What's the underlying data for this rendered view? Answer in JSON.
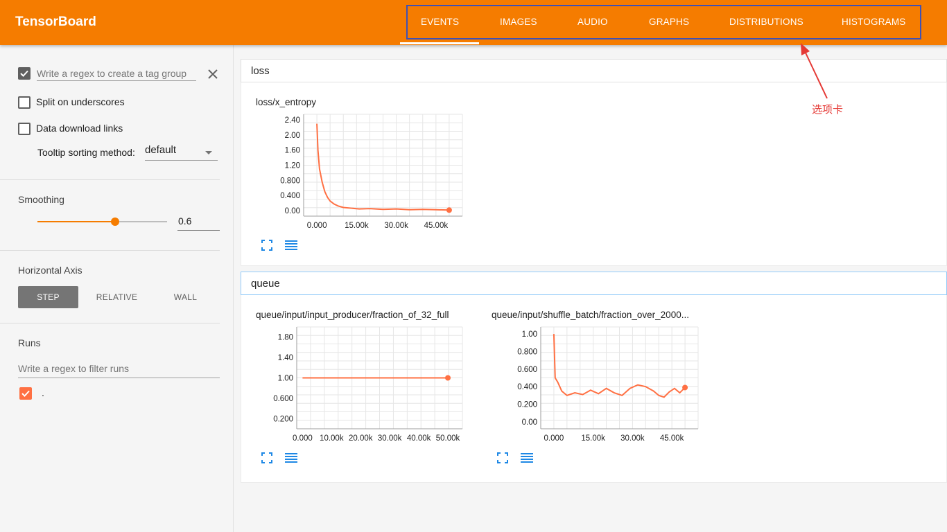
{
  "app": {
    "title": "TensorBoard"
  },
  "tabs": [
    {
      "label": "EVENTS",
      "active": true
    },
    {
      "label": "IMAGES"
    },
    {
      "label": "AUDIO"
    },
    {
      "label": "GRAPHS"
    },
    {
      "label": "DISTRIBUTIONS"
    },
    {
      "label": "HISTOGRAMS"
    }
  ],
  "annotation": {
    "text": "选项卡",
    "box_color": "#3f51b5",
    "text_color": "#e53935"
  },
  "sidebar": {
    "tag_regex": {
      "placeholder": "Write a regex to create a tag group",
      "checked": true
    },
    "split_underscores": {
      "label": "Split on underscores",
      "checked": false
    },
    "download_links": {
      "label": "Data download links",
      "checked": false
    },
    "tooltip": {
      "label": "Tooltip sorting method:",
      "value": "default"
    },
    "smoothing": {
      "title": "Smoothing",
      "value": "0.6",
      "fraction": 0.6
    },
    "horizontal_axis": {
      "title": "Horizontal Axis",
      "options": [
        "STEP",
        "RELATIVE",
        "WALL"
      ],
      "selected": "STEP"
    },
    "runs": {
      "title": "Runs",
      "placeholder": "Write a regex to filter runs",
      "items": [
        {
          "label": ".",
          "checked": true,
          "color": "#ff7043"
        }
      ]
    }
  },
  "groups": [
    {
      "name": "loss"
    },
    {
      "name": "queue"
    }
  ],
  "cards": {
    "loss": {
      "title": "loss/x_entropy"
    },
    "producer": {
      "title": "queue/input/input_producer/fraction_of_32_full"
    },
    "shuffle": {
      "title": "queue/input/shuffle_batch/fraction_over_2000..."
    }
  },
  "chart_data": [
    {
      "type": "line",
      "title": "loss/x_entropy",
      "y_ticks": [
        "2.40",
        "2.00",
        "1.60",
        "1.20",
        "0.800",
        "0.400",
        "0.00"
      ],
      "x_ticks": [
        "0.000",
        "15.00k",
        "30.00k",
        "45.00k"
      ],
      "xlim": [
        -5000,
        55000
      ],
      "ylim": [
        -0.15,
        2.55
      ],
      "series": [
        {
          "x": [
            0,
            400,
            1000,
            2000,
            3000,
            4000,
            5000,
            6500,
            8000,
            10000,
            13000,
            16000,
            20000,
            25000,
            30000,
            35000,
            40000,
            45000,
            50000
          ],
          "y": [
            2.3,
            1.6,
            1.1,
            0.75,
            0.5,
            0.35,
            0.25,
            0.17,
            0.12,
            0.08,
            0.06,
            0.04,
            0.05,
            0.03,
            0.04,
            0.02,
            0.03,
            0.02,
            0.01
          ]
        }
      ],
      "color": "#ff7043"
    },
    {
      "type": "line",
      "title": "queue/input/input_producer/fraction_of_32_full",
      "y_ticks": [
        "1.80",
        "1.40",
        "1.00",
        "0.600",
        "0.200"
      ],
      "x_ticks": [
        "0.000",
        "10.00k",
        "20.00k",
        "30.00k",
        "40.00k",
        "50.00k"
      ],
      "xlim": [
        -2000,
        55000
      ],
      "ylim": [
        0,
        2.0
      ],
      "series": [
        {
          "x": [
            0,
            50000
          ],
          "y": [
            1.0,
            1.0
          ]
        }
      ],
      "color": "#ff7043"
    },
    {
      "type": "line",
      "title": "queue/input/shuffle_batch/fraction_over_2000...",
      "y_ticks": [
        "1.00",
        "0.800",
        "0.600",
        "0.400",
        "0.200",
        "0.00"
      ],
      "x_ticks": [
        "0.000",
        "15.00k",
        "30.00k",
        "45.00k"
      ],
      "xlim": [
        -5000,
        55000
      ],
      "ylim": [
        -0.08,
        1.08
      ],
      "series": [
        {
          "x": [
            0,
            500,
            1500,
            3000,
            5000,
            8000,
            11000,
            14000,
            17000,
            20000,
            23000,
            26000,
            29000,
            32000,
            35000,
            38000,
            40000,
            42000,
            44000,
            46000,
            48000,
            50000
          ],
          "y": [
            1.0,
            0.5,
            0.45,
            0.35,
            0.3,
            0.33,
            0.31,
            0.36,
            0.32,
            0.38,
            0.33,
            0.3,
            0.38,
            0.42,
            0.4,
            0.35,
            0.3,
            0.28,
            0.34,
            0.38,
            0.33,
            0.39
          ]
        }
      ],
      "color": "#ff7043"
    }
  ]
}
